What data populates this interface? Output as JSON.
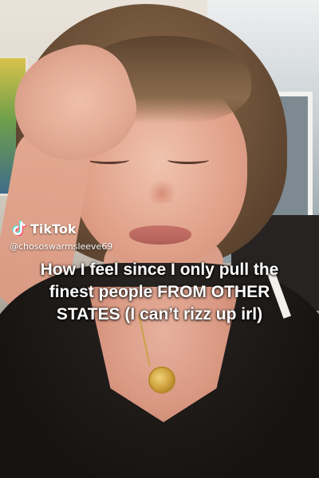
{
  "watermark": {
    "logo_icon": "tiktok-note-icon",
    "brand": "TikTok",
    "handle": "@chososwarmsleeve69"
  },
  "caption": {
    "text": "How I feel since I only pull the finest people FROM OTHER STATES (I can’t rizz up irl)"
  },
  "colors": {
    "caption_text": "#ffffff",
    "tiktok_cyan": "#25F4EE",
    "tiktok_red": "#FE2C55"
  }
}
